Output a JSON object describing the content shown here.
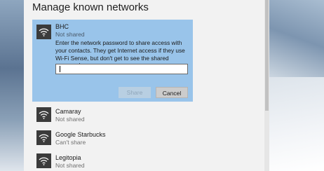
{
  "dialog": {
    "title": "Manage known networks",
    "selected": {
      "name": "BHC",
      "status": "Not shared",
      "description": "Enter the network password to share access with your contacts. They get Internet access if they use Wi-Fi Sense, but don't get to see the shared password.",
      "password_value": "",
      "share_label": "Share",
      "cancel_label": "Cancel"
    },
    "networks": [
      {
        "name": "Camaray",
        "status": "Not shared"
      },
      {
        "name": "Google Starbucks",
        "status": "Can't share"
      },
      {
        "name": "Legitopia",
        "status": "Not shared"
      }
    ]
  },
  "colors": {
    "selected_bg": "#99c4ea",
    "tile": "#3b3b3b"
  },
  "icons": {
    "network": "wifi-icon"
  }
}
